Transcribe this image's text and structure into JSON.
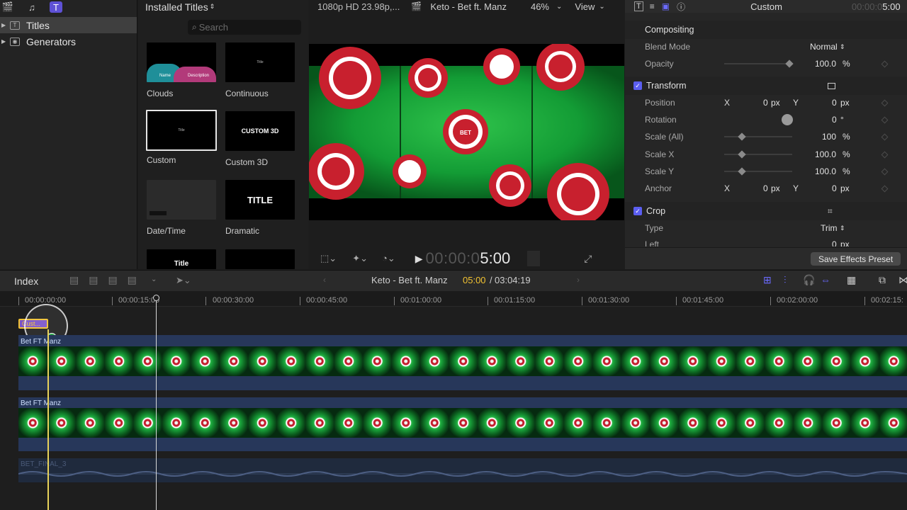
{
  "library_bar": {
    "icons": [
      "clapper-icon",
      "photos-icon",
      "titles-icon"
    ]
  },
  "sidebar": {
    "items": [
      {
        "label": "Titles",
        "icon": "titles-icon",
        "selected": true
      },
      {
        "label": "Generators",
        "icon": "generators-icon",
        "selected": false
      }
    ]
  },
  "browser": {
    "title": "Installed Titles",
    "search_placeholder": "Search",
    "tiles": [
      {
        "label": "Clouds",
        "thumb_text": ""
      },
      {
        "label": "Continuous",
        "thumb_text": "Title"
      },
      {
        "label": "Custom",
        "thumb_text": "Title",
        "selected": true
      },
      {
        "label": "Custom 3D",
        "thumb_text": "CUSTOM 3D"
      },
      {
        "label": "Date/Time",
        "thumb_text": ""
      },
      {
        "label": "Dramatic",
        "thumb_text": "TITLE"
      },
      {
        "label": "",
        "thumb_text": "Title"
      },
      {
        "label": "",
        "thumb_text": ""
      }
    ],
    "clouds_words": [
      "Name",
      "Description"
    ]
  },
  "viewer": {
    "format": "1080p HD 23.98p,...",
    "project": "Keto - Bet ft. Manz",
    "zoom": "46%",
    "view_label": "View",
    "timecode_dim": "00:00:0",
    "timecode_bright": "5:00",
    "chip_text": "BET"
  },
  "inspector": {
    "title": "Custom",
    "timecode_dim": "00:00:0",
    "timecode_bright": "5:00",
    "compositing": "Compositing",
    "blend_mode_label": "Blend Mode",
    "blend_mode_value": "Normal",
    "opacity_label": "Opacity",
    "opacity_value": "100.0",
    "opacity_unit": "%",
    "transform": "Transform",
    "position_label": "Position",
    "pos_x_label": "X",
    "pos_x_value": "0",
    "pos_y_label": "Y",
    "pos_y_value": "0",
    "px": "px",
    "rotation_label": "Rotation",
    "rotation_value": "0",
    "degree": "°",
    "scale_all_label": "Scale (All)",
    "scale_all_value": "100",
    "scale_x_label": "Scale X",
    "scale_x_value": "100.0",
    "scale_y_label": "Scale Y",
    "scale_y_value": "100.0",
    "anchor_label": "Anchor",
    "anchor_x_value": "0",
    "anchor_y_value": "0",
    "crop": "Crop",
    "type_label": "Type",
    "type_value": "Trim",
    "left_label": "Left",
    "left_value": "0",
    "save_preset": "Save Effects Preset"
  },
  "timeline_bar": {
    "index": "Index",
    "project": "Keto - Bet ft. Manz",
    "current": "05:00",
    "separator": "/",
    "duration": "03:04:19"
  },
  "timeline": {
    "ruler": [
      "00:00:00:00",
      "00:00:15:00",
      "00:00:30:00",
      "00:00:45:00",
      "00:01:00:00",
      "00:01:15:00",
      "00:01:30:00",
      "00:01:45:00",
      "00:02:00:00",
      "00:02:15:"
    ],
    "title_clip": "Cust...",
    "clip1": "Bet FT Manz",
    "clip2": "Bet FT Manz",
    "audio_clip": "BET_FINAL_3"
  },
  "colors": {
    "accent": "#5b5ef0",
    "playhead": "#e8d25a",
    "title_clip": "#7a53c9"
  }
}
